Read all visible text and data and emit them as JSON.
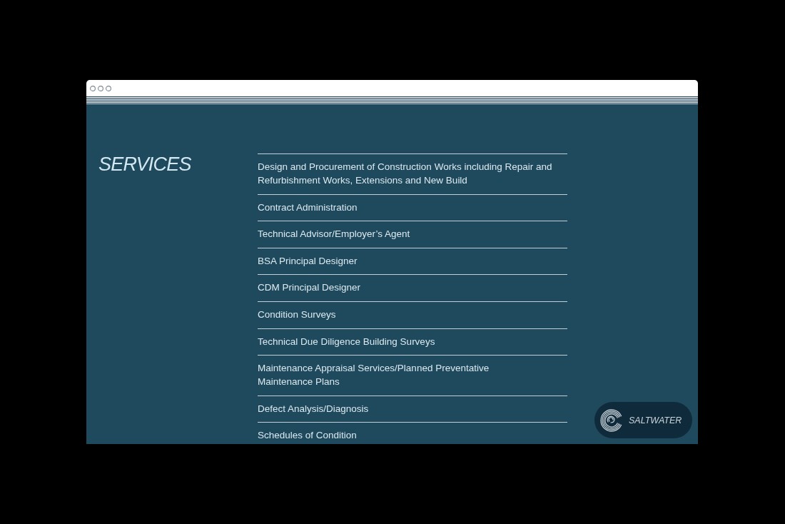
{
  "page": {
    "heading": "SERVICES",
    "services": [
      "Design and Procurement of Construction Works including Repair and Refurbishment Works, Extensions and New Build",
      "Contract Administration",
      "Technical Advisor/Employer’s Agent",
      "BSA Principal Designer",
      "CDM Principal Designer",
      "Condition Surveys",
      "Technical Due Diligence Building Surveys",
      "Maintenance Appraisal Services/Planned Preventative\nMaintenance Plans",
      "Defect Analysis/Diagnosis",
      "Schedules of Condition"
    ]
  },
  "badge": {
    "label": "SALTWATER"
  }
}
